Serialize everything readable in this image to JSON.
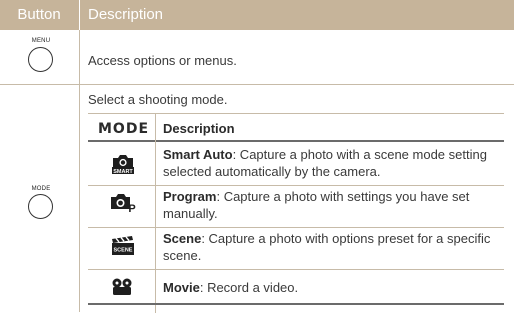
{
  "header": {
    "button": "Button",
    "description": "Description"
  },
  "menu_row": {
    "label": "MENU",
    "description": "Access options or menus."
  },
  "mode_row": {
    "label": "MODE",
    "intro": "Select a shooting mode.",
    "table": {
      "col_mode": "MODE",
      "col_desc": "Description",
      "rows": [
        {
          "icon": "smart-auto-icon",
          "icon_text": "SMART",
          "name": "Smart Auto",
          "text": ": Capture a photo with a scene mode setting selected automatically by the camera."
        },
        {
          "icon": "program-icon",
          "icon_text": "P",
          "name": "Program",
          "text": ": Capture a photo with settings you have set manually."
        },
        {
          "icon": "scene-icon",
          "icon_text": "SCENE",
          "name": "Scene",
          "text": ": Capture a photo with options preset for a specific scene."
        },
        {
          "icon": "movie-icon",
          "icon_text": "",
          "name": "Movie",
          "text": ": Record a video."
        }
      ]
    }
  },
  "colors": {
    "header_bg": "#c6b49a",
    "rule": "#c7bba8"
  }
}
